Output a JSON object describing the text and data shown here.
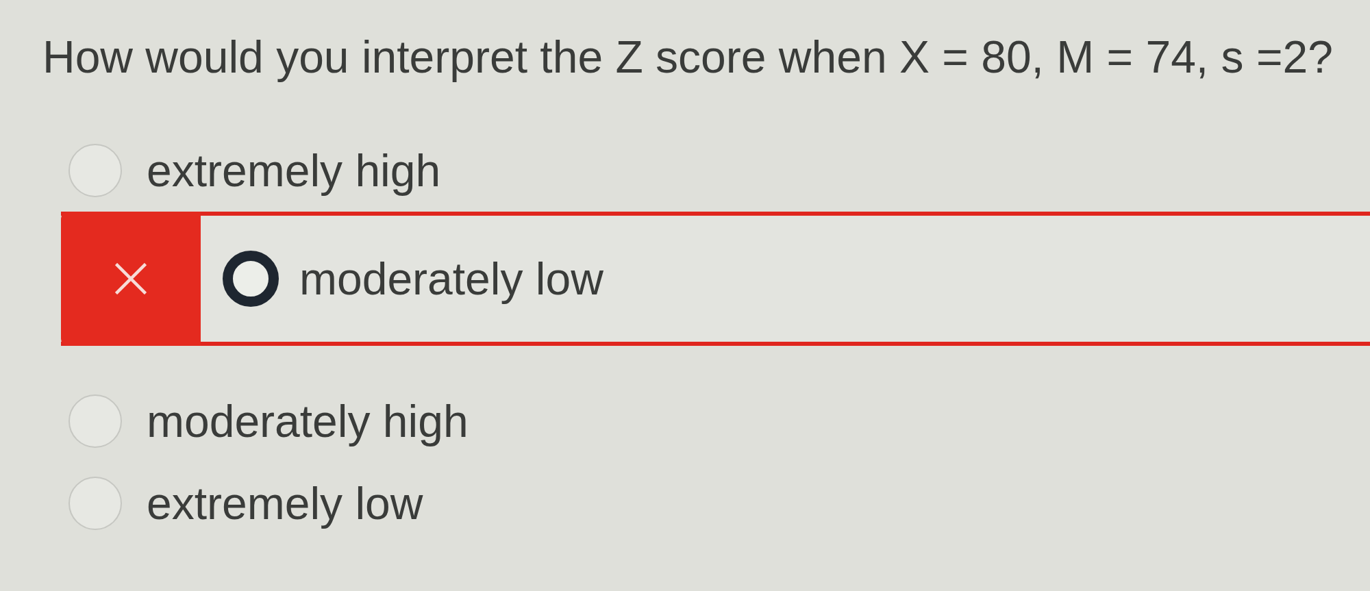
{
  "question": {
    "text": "How would you interpret the Z score when X = 80, M = 74, s =2?"
  },
  "options": [
    {
      "label": "extremely high",
      "selected": false,
      "marked_incorrect": false
    },
    {
      "label": "moderately low",
      "selected": true,
      "marked_incorrect": true
    },
    {
      "label": "moderately high",
      "selected": false,
      "marked_incorrect": false
    },
    {
      "label": "extremely low",
      "selected": false,
      "marked_incorrect": false
    }
  ]
}
